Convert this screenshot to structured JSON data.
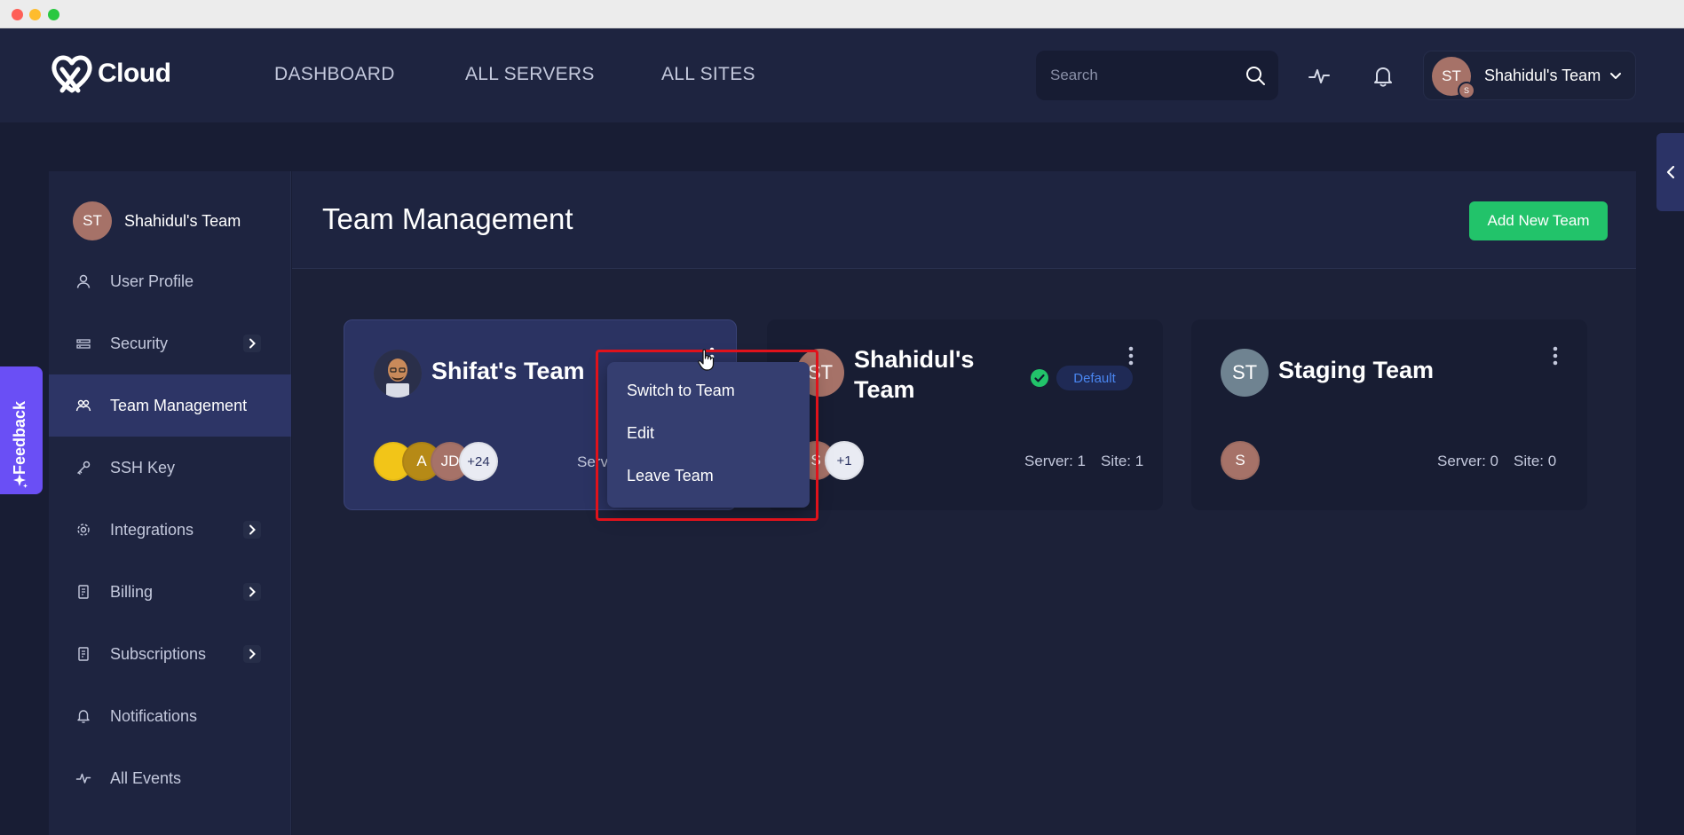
{
  "app": {
    "logo_text": "Cloud"
  },
  "nav": {
    "dashboard": "DASHBOARD",
    "all_servers": "ALL SERVERS",
    "all_sites": "ALL SITES"
  },
  "search": {
    "placeholder": "Search"
  },
  "account": {
    "initials": "ST",
    "mini_initial": "S",
    "name": "Shahidul's Team"
  },
  "sidebar": {
    "team_initials": "ST",
    "team_name": "Shahidul's Team",
    "items": [
      {
        "label": "User Profile",
        "icon": "user-icon"
      },
      {
        "label": "Security",
        "icon": "security-icon"
      },
      {
        "label": "Team Management",
        "icon": "team-icon"
      },
      {
        "label": "SSH Key",
        "icon": "key-icon"
      },
      {
        "label": "Integrations",
        "icon": "gear-icon"
      },
      {
        "label": "Billing",
        "icon": "billing-icon"
      },
      {
        "label": "Subscriptions",
        "icon": "subscription-icon"
      },
      {
        "label": "Notifications",
        "icon": "bell-icon"
      },
      {
        "label": "All Events",
        "icon": "pulse-icon"
      }
    ]
  },
  "main": {
    "title": "Team Management",
    "add_button": "Add New Team"
  },
  "cards": [
    {
      "name": "Shifat's Team",
      "members": [
        "",
        "A",
        "JD",
        "+24"
      ],
      "stats": "Serv"
    },
    {
      "initials": "ST",
      "name_line1": "Shahidul's",
      "name_line2": "Team",
      "badge": "Default",
      "members": [
        "S",
        "+1"
      ],
      "servers": "Server: 1",
      "sites": "Site: 1"
    },
    {
      "initials": "ST",
      "name": "Staging Team",
      "members": [
        "S"
      ],
      "servers": "Server: 0",
      "sites": "Site: 0"
    }
  ],
  "dropdown": {
    "items": [
      "Switch to Team",
      "Edit",
      "Leave Team"
    ]
  },
  "feedback": {
    "label": "Feedback"
  },
  "colors": {
    "accent_green": "#22c36a",
    "feedback_purple": "#6a4ff5",
    "highlight_red": "#e0121b",
    "default_blue": "#4a86f0"
  }
}
